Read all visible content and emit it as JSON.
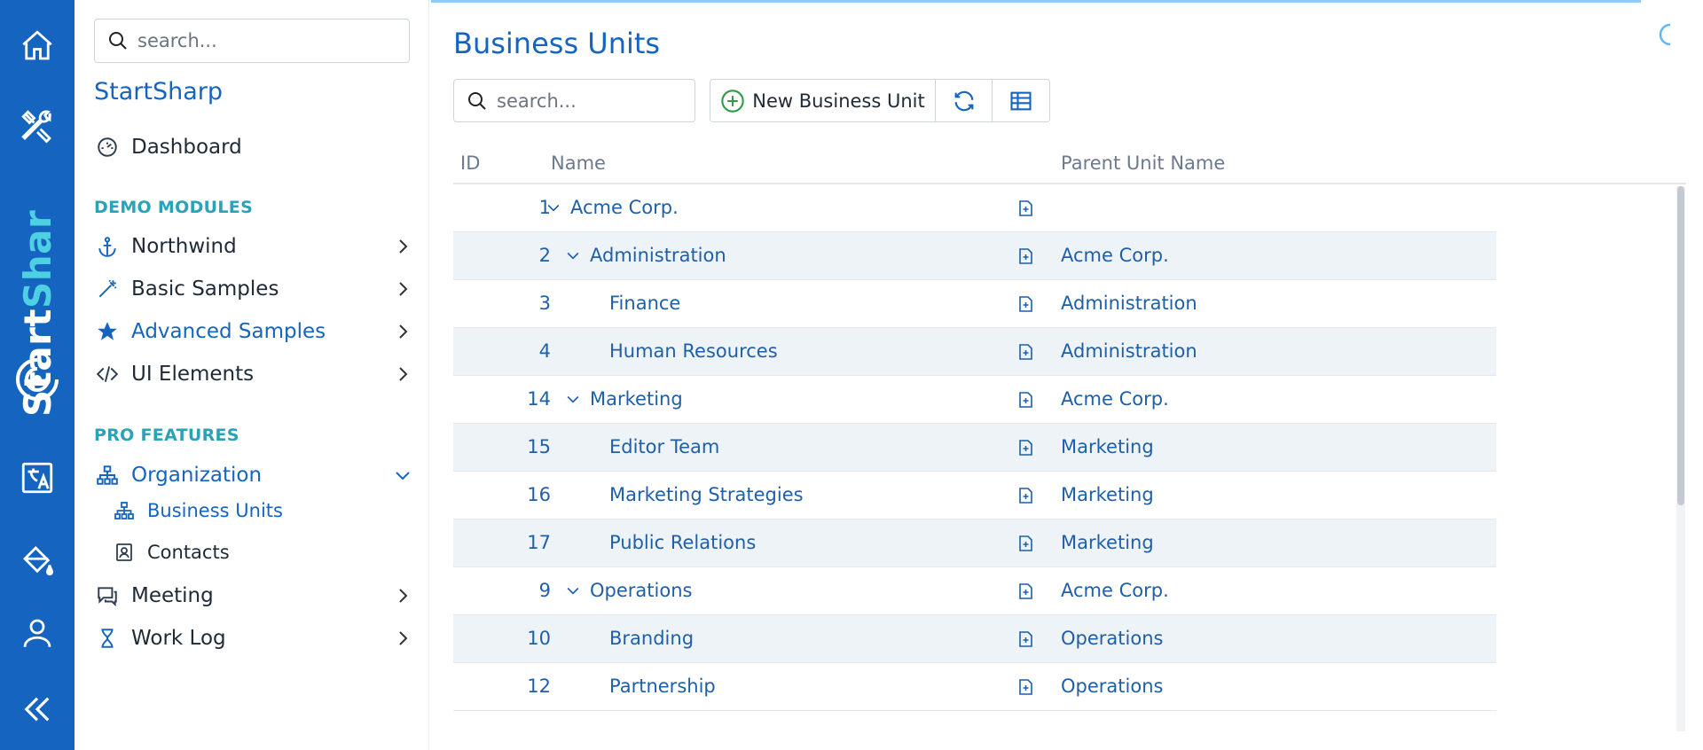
{
  "rail": {
    "brand_white": "Start",
    "brand_cyan": "Shar",
    "icons": [
      "home-icon",
      "tools-icon",
      "translate-icon",
      "paint-bucket-icon",
      "user-icon",
      "collapse-icon"
    ]
  },
  "sidebar": {
    "search_placeholder": "search...",
    "app_title": "StartSharp",
    "dashboard_label": "Dashboard",
    "section_demo": "DEMO MODULES",
    "northwind_label": "Northwind",
    "basic_samples_label": "Basic Samples",
    "advanced_samples_label": "Advanced Samples",
    "ui_elements_label": "UI Elements",
    "section_pro": "PRO FEATURES",
    "organization_label": "Organization",
    "business_units_label": "Business Units",
    "contacts_label": "Contacts",
    "meeting_label": "Meeting",
    "work_log_label": "Work Log"
  },
  "main": {
    "title": "Business Units",
    "search_placeholder": "search...",
    "new_button_label": "New Business Unit"
  },
  "grid": {
    "col_id": "ID",
    "col_name": "Name",
    "col_parent": "Parent Unit Name",
    "rows": [
      {
        "id": "1",
        "name": "Acme Corp.",
        "parent": "",
        "level": 0,
        "expandable": true
      },
      {
        "id": "2",
        "name": "Administration",
        "parent": "Acme Corp.",
        "level": 1,
        "expandable": true
      },
      {
        "id": "3",
        "name": "Finance",
        "parent": "Administration",
        "level": 2,
        "expandable": false
      },
      {
        "id": "4",
        "name": "Human Resources",
        "parent": "Administration",
        "level": 2,
        "expandable": false
      },
      {
        "id": "14",
        "name": "Marketing",
        "parent": "Acme Corp.",
        "level": 1,
        "expandable": true
      },
      {
        "id": "15",
        "name": "Editor Team",
        "parent": "Marketing",
        "level": 2,
        "expandable": false
      },
      {
        "id": "16",
        "name": "Marketing Strategies",
        "parent": "Marketing",
        "level": 2,
        "expandable": false
      },
      {
        "id": "17",
        "name": "Public Relations",
        "parent": "Marketing",
        "level": 2,
        "expandable": false
      },
      {
        "id": "9",
        "name": "Operations",
        "parent": "Acme Corp.",
        "level": 1,
        "expandable": true
      },
      {
        "id": "10",
        "name": "Branding",
        "parent": "Operations",
        "level": 2,
        "expandable": false
      },
      {
        "id": "12",
        "name": "Partnership",
        "parent": "Operations",
        "level": 2,
        "expandable": false
      }
    ]
  },
  "colors": {
    "primary": "#1565c0",
    "accent_cyan": "#4dd0e1",
    "section_label": "#2aa3b8",
    "row_alt": "#eef3f8",
    "link": "#1f5fa8"
  }
}
